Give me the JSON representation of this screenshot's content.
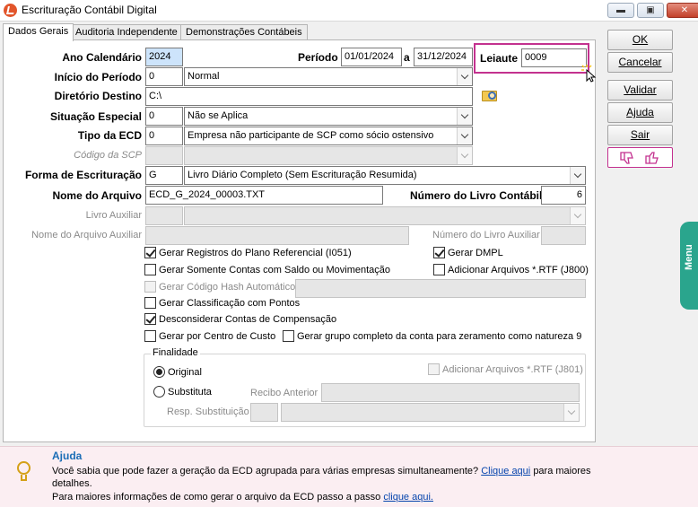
{
  "window": {
    "title": "Escrituração Contábil Digital",
    "minimize": "▬",
    "restore": "▣",
    "close": "✕"
  },
  "tabs": [
    "Dados Gerais",
    "Auditoria Independente",
    "Demonstrações Contábeis"
  ],
  "form": {
    "ano_calendario": {
      "label": "Ano Calendário",
      "value": "2024"
    },
    "periodo": {
      "label": "Período",
      "start": "01/01/2024",
      "sep": "a",
      "end": "31/12/2024"
    },
    "leiaute": {
      "label": "Leiaute",
      "value": "0009"
    },
    "inicio_periodo": {
      "label": "Início do Período",
      "code": "0",
      "value": "Normal"
    },
    "diretorio_destino": {
      "label": "Diretório Destino",
      "value": "C:\\"
    },
    "situacao_especial": {
      "label": "Situação Especial",
      "code": "0",
      "value": "Não se Aplica"
    },
    "tipo_ecd": {
      "label": "Tipo da ECD",
      "code": "0",
      "value": "Empresa não participante de SCP como sócio ostensivo"
    },
    "codigo_scp": {
      "label": "Código da SCP",
      "value": ""
    },
    "forma_escrituracao": {
      "label": "Forma de Escrituração",
      "code": "G",
      "value": "Livro Diário Completo (Sem Escrituração Resumida)"
    },
    "nome_arquivo": {
      "label": "Nome do Arquivo",
      "value": "ECD_G_2024_00003.TXT"
    },
    "numero_livro": {
      "label": "Número do Livro Contábil",
      "value": "6"
    },
    "livro_auxiliar": {
      "label": "Livro Auxiliar",
      "value": ""
    },
    "nome_arquivo_auxiliar": {
      "label": "Nome do Arquivo Auxiliar",
      "value": ""
    },
    "numero_livro_auxiliar": {
      "label": "Número do Livro Auxiliar",
      "value": ""
    }
  },
  "checkboxes": {
    "plano_referencial": {
      "label": "Gerar Registros do Plano Referencial (I051)",
      "checked": true
    },
    "dmpl": {
      "label": "Gerar DMPL",
      "checked": true
    },
    "somente_contas": {
      "label": "Gerar Somente Contas com Saldo ou Movimentação",
      "checked": false
    },
    "rtf_j800": {
      "label": "Adicionar Arquivos *.RTF (J800)",
      "checked": false
    },
    "hash": {
      "label": "Gerar Código Hash Automático",
      "checked": false
    },
    "classificacao": {
      "label": "Gerar Classificação com Pontos",
      "checked": false
    },
    "compensacao": {
      "label": "Desconsiderar Contas de Compensação",
      "checked": true
    },
    "centro_custo": {
      "label": "Gerar por Centro de Custo",
      "checked": false
    },
    "grupo_completo": {
      "label": "Gerar grupo completo da conta para zeramento como natureza 9",
      "checked": false
    }
  },
  "finalidade": {
    "title": "Finalidade",
    "original": "Original",
    "substituta": "Substituta",
    "recibo_anterior": "Recibo Anterior",
    "resp_substituicao": "Resp. Substituição",
    "rtf_j801": "Adicionar Arquivos *.RTF (J801)"
  },
  "buttons": {
    "ok": "OK",
    "cancelar": "Cancelar",
    "validar": "Validar",
    "ajuda": "Ajuda",
    "sair": "Sair"
  },
  "menu_tab": "Menu",
  "help": {
    "title": "Ajuda",
    "line1": "Você sabia que pode fazer a geração da ECD agrupada para várias empresas simultaneamente?",
    "link1": "Clique aqui",
    "line1_end": "para maiores",
    "line2": "detalhes.",
    "line3": "Para maiores informações de como gerar o arquivo da ECD passo a passo",
    "link2": "clique aqui."
  },
  "colors": {
    "accent": "#c3318f",
    "menu": "#2aa58d",
    "help_bg": "#fbeef2",
    "help_title": "#1a6db6"
  }
}
